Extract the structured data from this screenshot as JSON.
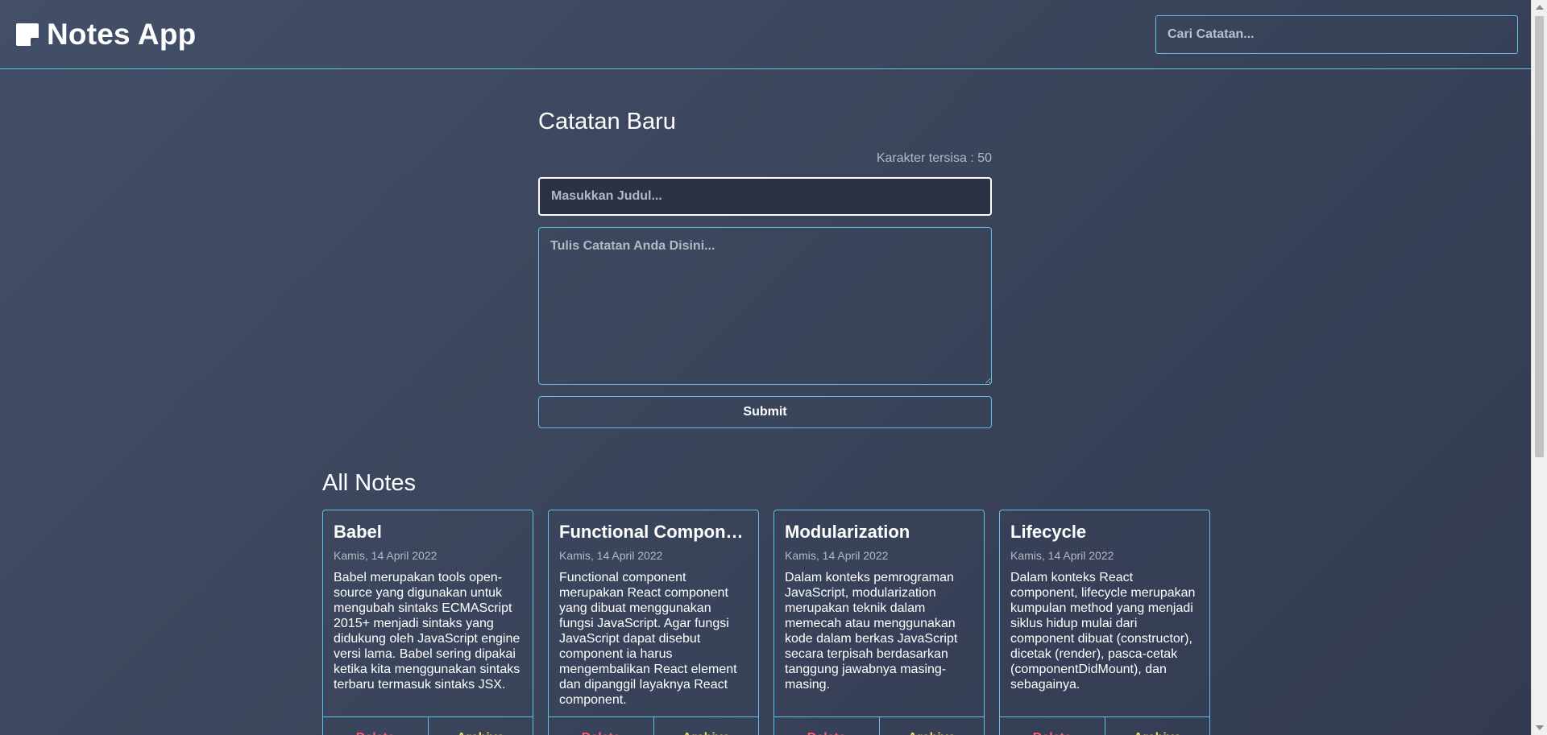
{
  "header": {
    "title": "Notes App",
    "logo_icon": "sticky-note-icon",
    "search_placeholder": "Cari Catatan..."
  },
  "new_note": {
    "heading": "Catatan Baru",
    "char_remaining": "Karakter tersisa : 50",
    "title_placeholder": "Masukkan Judul...",
    "body_placeholder": "Tulis Catatan Anda Disini...",
    "submit_label": "Submit"
  },
  "notes_section": {
    "heading": "All Notes",
    "notes": [
      {
        "title": "Babel",
        "date": "Kamis, 14 April 2022",
        "body": "Babel merupakan tools open-source yang digunakan untuk mengubah sintaks ECMAScript 2015+ menjadi sintaks yang didukung oleh JavaScript engine versi lama. Babel sering dipakai ketika kita menggunakan sintaks terbaru termasuk sintaks JSX.",
        "delete_label": "Delete",
        "archive_label": "Archive"
      },
      {
        "title": "Functional Component",
        "date": "Kamis, 14 April 2022",
        "body": "Functional component merupakan React component yang dibuat menggunakan fungsi JavaScript. Agar fungsi JavaScript dapat disebut component ia harus mengembalikan React element dan dipanggil layaknya React component.",
        "delete_label": "Delete",
        "archive_label": "Archive"
      },
      {
        "title": "Modularization",
        "date": "Kamis, 14 April 2022",
        "body": "Dalam konteks pemrograman JavaScript, modularization merupakan teknik dalam memecah atau menggunakan kode dalam berkas JavaScript secara terpisah berdasarkan tanggung jawabnya masing-masing.",
        "delete_label": "Delete",
        "archive_label": "Archive"
      },
      {
        "title": "Lifecycle",
        "date": "Kamis, 14 April 2022",
        "body": "Dalam konteks React component, lifecycle merupakan kumpulan method yang menjadi siklus hidup mulai dari component dibuat (constructor), dicetak (render), pasca-cetak (componentDidMount), dan sebagainya.",
        "delete_label": "Delete",
        "archive_label": "Archive"
      }
    ]
  },
  "colors": {
    "accent_border": "#5fc1e6",
    "delete": "#ff5f6d",
    "archive": "#f2d65c",
    "muted_text": "#b3b8c4"
  }
}
